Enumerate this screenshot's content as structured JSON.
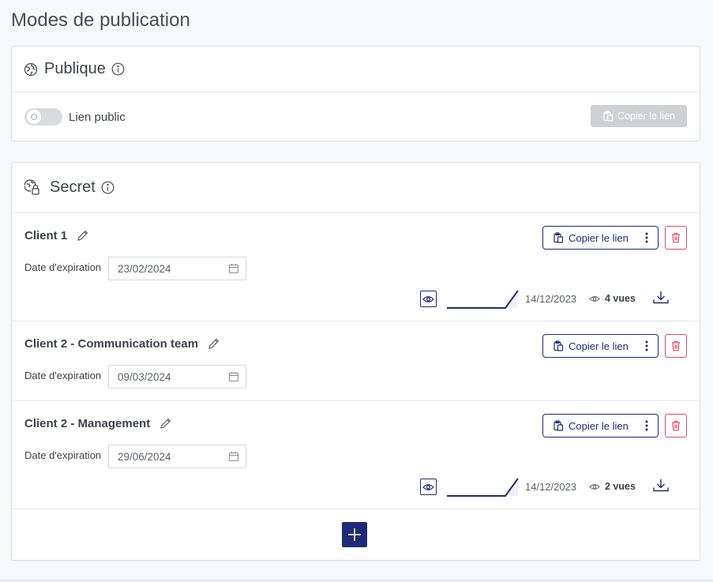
{
  "page": {
    "title": "Modes de publication"
  },
  "public": {
    "title": "Publique",
    "toggle_label": "Lien public",
    "copy_label": "Copier le lien"
  },
  "secret": {
    "title": "Secret",
    "expiration_label": "Date d'expiration",
    "copy_label": "Copier le lien",
    "clients": [
      {
        "name": "Client 1",
        "expiration": "23/02/2024",
        "stat_date": "14/12/2023",
        "views": "4 vues"
      },
      {
        "name": "Client 2 - Communication team",
        "expiration": "09/03/2024"
      },
      {
        "name": "Client 2 - Management",
        "expiration": "29/06/2024",
        "stat_date": "14/12/2023",
        "views": "2 vues"
      }
    ]
  },
  "colors": {
    "primary": "#1e2a78",
    "danger": "#e04a6c",
    "disabled": "#cfd1d5"
  }
}
